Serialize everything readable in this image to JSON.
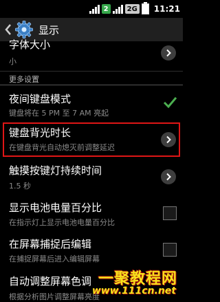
{
  "status_bar": {
    "sim_badge": "2",
    "network_badge": "2G",
    "time": "11:21"
  },
  "action_bar": {
    "title": "显示"
  },
  "list": {
    "font_size": {
      "label": "字体大小",
      "value": "小"
    },
    "section_more": "更多设置",
    "night_keyboard": {
      "label": "夜间键盘模式",
      "summary": "键盘将在 5 PM 至 7 AM 亮起",
      "checked": true
    },
    "backlight_duration": {
      "label": "键盘背光时长",
      "summary": "在键盘背光自动熄灭前调整延迟"
    },
    "touch_key_duration": {
      "label": "触摸按键灯持续时间",
      "value": "1.5 秒"
    },
    "battery_percent": {
      "label": "显示电池电量百分比",
      "summary": "在指示灯上显示电池电量百分比",
      "checked": false
    },
    "screenshot_edit": {
      "label": "在屏幕捕捉后编辑",
      "summary": "在捕捉屏幕后进入编辑屏幕",
      "checked": false
    },
    "auto_tone": {
      "label": "自动调整屏幕色调",
      "summary": "根据分析图片调整屏幕亮度"
    }
  },
  "watermark": {
    "line1": "一聚教程网",
    "line2": "www.111cn.net"
  },
  "colors": {
    "highlight": "#e01616",
    "check": "#4caf50",
    "accent": "#33b5e5"
  }
}
